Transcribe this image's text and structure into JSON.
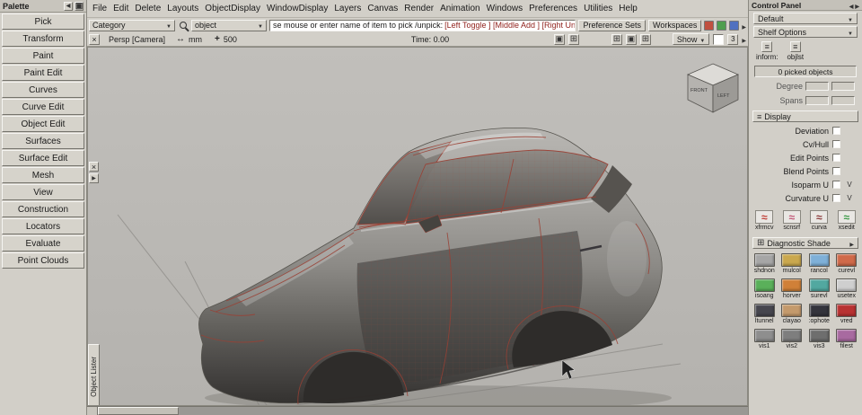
{
  "menubar": {
    "items": [
      "File",
      "Edit",
      "Delete",
      "Layouts",
      "ObjectDisplay",
      "WindowDisplay",
      "Layers",
      "Canvas",
      "Render",
      "Animation",
      "Windows",
      "Preferences",
      "Utilities",
      "Help"
    ]
  },
  "palette": {
    "title": "Palette",
    "items": [
      "Pick",
      "Transform",
      "Paint",
      "Paint Edit",
      "Curves",
      "Curve Edit",
      "Object Edit",
      "Surfaces",
      "Surface Edit",
      "Mesh",
      "View",
      "Construction",
      "Locators",
      "Evaluate",
      "Point Clouds"
    ]
  },
  "toolbar": {
    "category_label": "Category",
    "object_label": "object",
    "prompt_main": "se mouse or enter name of item to pick /unpick:",
    "prompt_accent": "[Left Toggle ] [Middle Add ] [Right Unpick]",
    "preference_sets_label": "Preference Sets",
    "workspaces_label": "Workspaces"
  },
  "viewbar": {
    "camera_label": "Persp [Camera]",
    "units_label": "mm",
    "grid_value": "500",
    "time_label": "Time: 0.00",
    "show_label": "Show",
    "frame_value": "3"
  },
  "viewport": {
    "object_lister_label": "Object Lister",
    "viewcube": {
      "face_front": "FRONT",
      "face_left": "LEFT"
    }
  },
  "control_panel": {
    "title": "Control Panel",
    "preset_value": "Default",
    "shelf_options_label": "Shelf Options",
    "inform_label": "inform:",
    "objlst_label": "objlst",
    "picked_status": "0 picked objects",
    "degree_label": "Degree",
    "spans_label": "Spans",
    "display_header": "Display",
    "checks": [
      {
        "label": "Deviation"
      },
      {
        "label": "Cv/Hull"
      },
      {
        "label": "Edit Points"
      },
      {
        "label": "Blend Points"
      },
      {
        "label": "Isoparm U",
        "v": "V"
      },
      {
        "label": "Curvature U",
        "v": "V"
      }
    ],
    "tools": [
      {
        "label": "xfrmcv",
        "color": "#c03c34"
      },
      {
        "label": "scnsrf",
        "color": "#c25878"
      },
      {
        "label": "curva",
        "color": "#8a3a3a"
      },
      {
        "label": "xsedit",
        "color": "#3a9a46"
      }
    ],
    "diagnostic_header": "Diagnostic Shade",
    "shaders": [
      {
        "label": "shdnon",
        "color": "#a6a6a6"
      },
      {
        "label": "mulcol",
        "color": "#caa84e"
      },
      {
        "label": "rancol",
        "color": "#7fb0d8"
      },
      {
        "label": "curevl",
        "color": "#d06a4a"
      },
      {
        "label": "isoang",
        "color": "#5ab05a"
      },
      {
        "label": "horver",
        "color": "#d08038"
      },
      {
        "label": "surevl",
        "color": "#52a8a0"
      },
      {
        "label": "usetex",
        "color": "#cfcfcf"
      },
      {
        "label": "ltunnel",
        "color": "#46464e"
      },
      {
        "label": "clayao",
        "color": "#c49a6c"
      },
      {
        "label": ":ophote",
        "color": "#34343c"
      },
      {
        "label": "vred",
        "color": "#b83232"
      },
      {
        "label": "vis1",
        "color": "#8e8e8e"
      },
      {
        "label": "vis2",
        "color": "#7e7e7e"
      },
      {
        "label": "vis3",
        "color": "#6e6e6e"
      },
      {
        "label": "filest",
        "color": "#a86aa0"
      }
    ]
  },
  "colors": {
    "wireframe_red": "#9a4034",
    "viewport_bg": "#babab6"
  }
}
